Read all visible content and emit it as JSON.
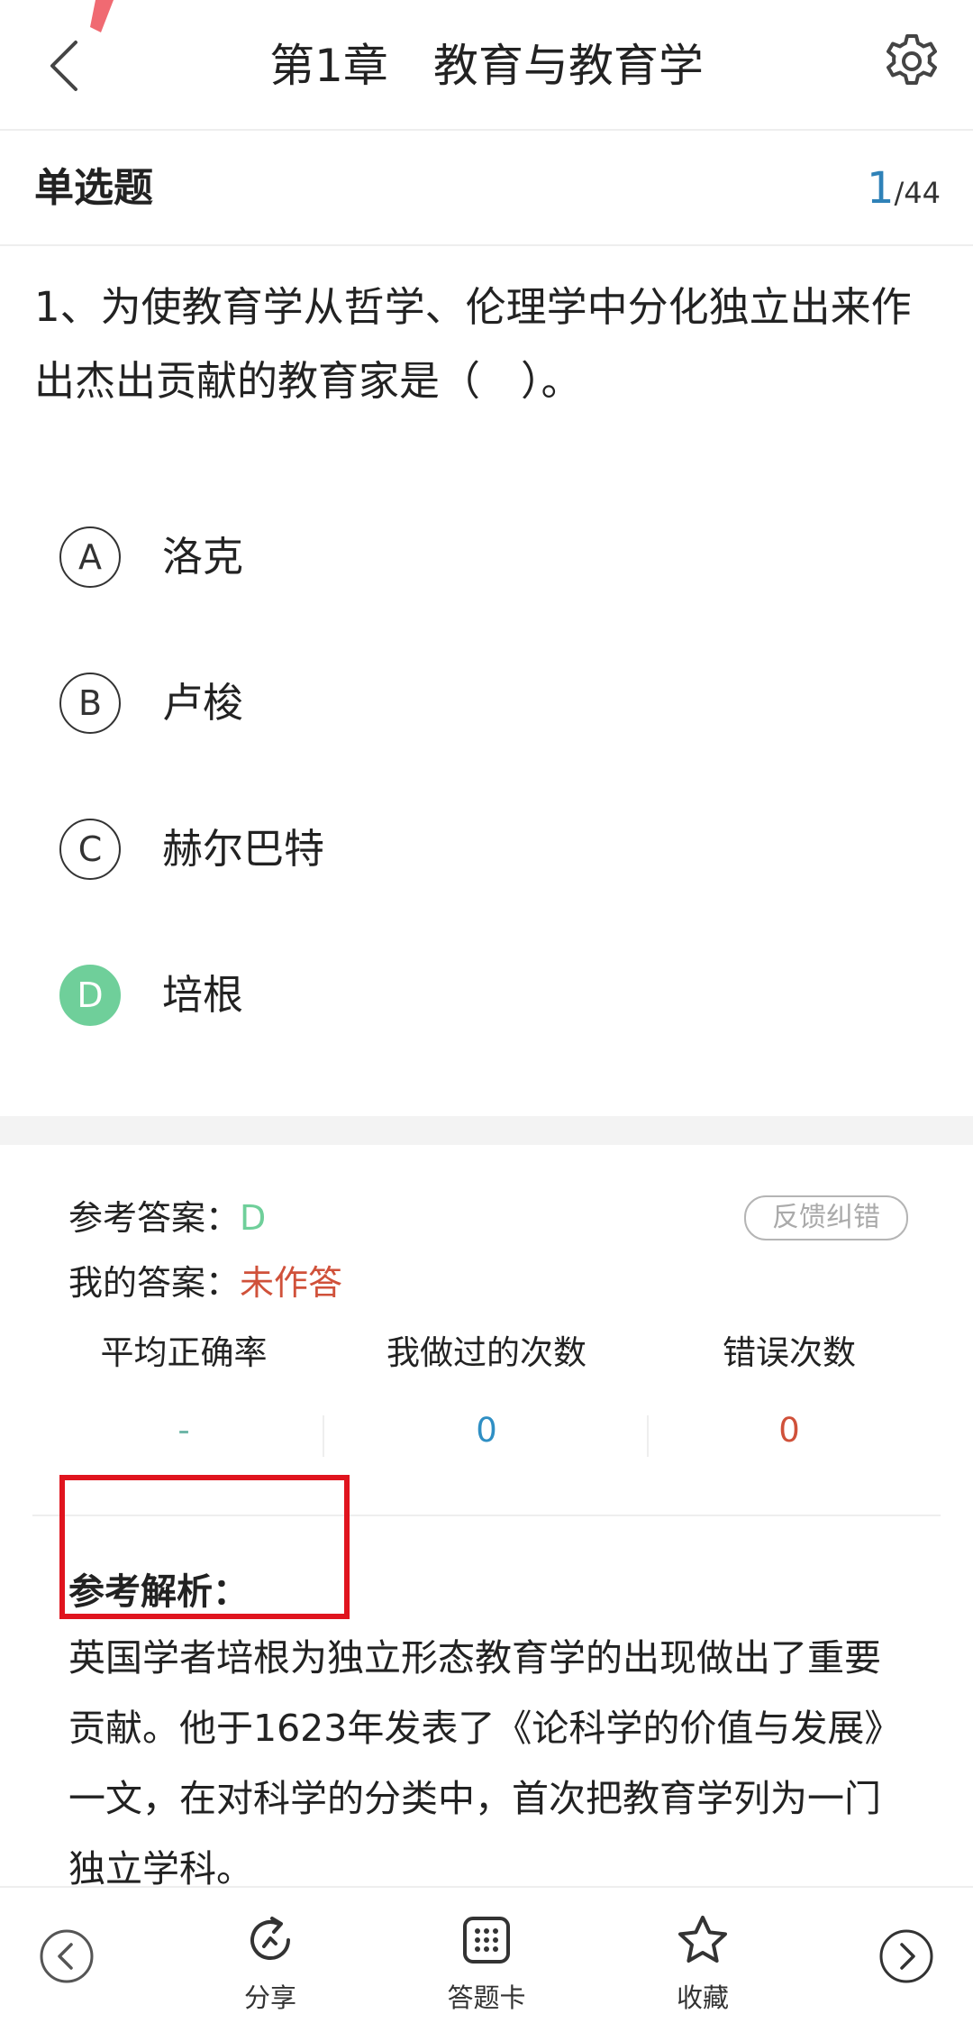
{
  "header": {
    "title": "第1章　教育与教育学"
  },
  "question_meta": {
    "type": "单选题",
    "current": "1",
    "separator": "/",
    "total": "44"
  },
  "question": {
    "text": "1、为使教育学从哲学、伦理学中分化独立出来作出杰出贡献的教育家是（　）。",
    "options": [
      {
        "letter": "A",
        "text": "洛克"
      },
      {
        "letter": "B",
        "text": "卢梭"
      },
      {
        "letter": "C",
        "text": "赫尔巴特"
      },
      {
        "letter": "D",
        "text": "培根"
      }
    ],
    "correct_letter": "D"
  },
  "answer": {
    "ref_label": "参考答案：",
    "ref_value": "D",
    "my_label": "我的答案：",
    "my_value": "未作答",
    "feedback_label": "反馈纠错"
  },
  "stats": [
    {
      "label": "平均正确率",
      "value": "-",
      "color": "#6fb7a8"
    },
    {
      "label": "我做过的次数",
      "value": "0",
      "color": "#2f8fc4"
    },
    {
      "label": "错误次数",
      "value": "0",
      "color": "#d0513a"
    }
  ],
  "analysis": {
    "title": "参考解析：",
    "body": "英国学者培根为独立形态教育学的出现做出了重要贡献。他于1623年发表了《论科学的价值与发展》一文，在对科学的分类中，首次把教育学列为一门独立学科。"
  },
  "bottom_bar": {
    "share_label": "分享",
    "card_label": "答题卡",
    "favorite_label": "收藏"
  },
  "colors": {
    "correct": "#6fcf9a",
    "wrong": "#d0513a",
    "accent": "#2f82b8",
    "highlight": "#e0141e"
  }
}
